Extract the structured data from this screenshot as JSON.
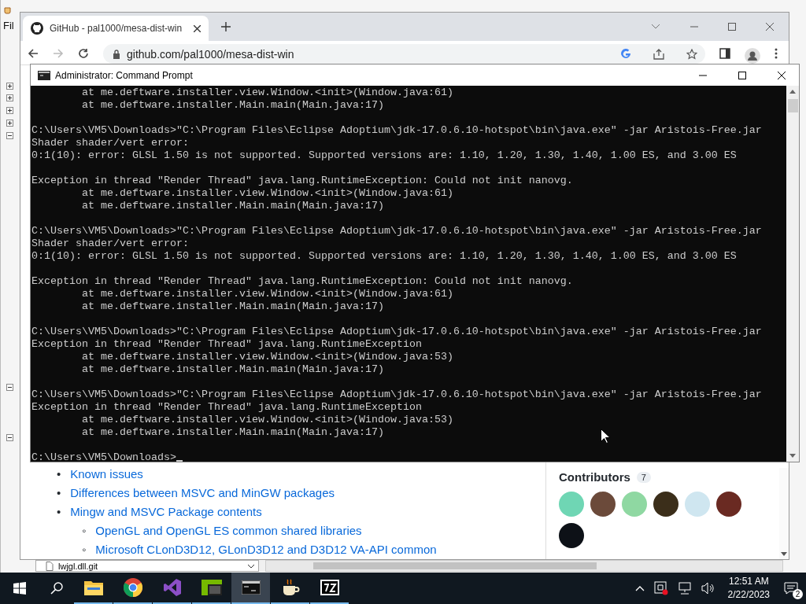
{
  "background_app": {
    "menu": "Fil",
    "tree_nodes": [
      {
        "expanded": false
      },
      {
        "expanded": false
      },
      {
        "expanded": false
      },
      {
        "expanded": false
      },
      {
        "expanded": true
      },
      {
        "expanded": true
      },
      {
        "expanded": true
      }
    ],
    "file": "lwjgl.dll.git"
  },
  "browser": {
    "tab_title": "GitHub - pal1000/mesa-dist-win",
    "url": "github.com/pal1000/mesa-dist-win",
    "toc": [
      {
        "marker": "•",
        "text": "Known issues"
      },
      {
        "marker": "•",
        "text": "Differences between MSVC and MinGW packages"
      },
      {
        "marker": "•",
        "text": "Mingw and MSVC Package contents",
        "children": [
          {
            "marker": "◦",
            "text": "OpenGL and OpenGL ES common shared libraries"
          },
          {
            "marker": "◦",
            "text": "Microsoft CLonD3D12, GLonD3D12 and D3D12 VA-API common"
          }
        ]
      }
    ],
    "contributors": {
      "title": "Contributors",
      "count": "7",
      "avatars": [
        {
          "color": "#6fd6b4"
        },
        {
          "color": "#6b4a3a"
        },
        {
          "color": "#8fd8a2"
        },
        {
          "color": "#3b2e1a"
        },
        {
          "color": "#cfe6f0"
        },
        {
          "color": "#6a2a22"
        },
        {
          "color": "#0d1117"
        }
      ]
    }
  },
  "console": {
    "title": "Administrator:  Command Prompt",
    "blocks": [
      [
        "        at me.deftware.installer.view.Window.<init>(Window.java:61)",
        "        at me.deftware.installer.Main.main(Main.java:17)"
      ],
      [
        "C:\\Users\\VM5\\Downloads>\"C:\\Program Files\\Eclipse Adoptium\\jdk-17.0.6.10-hotspot\\bin\\java.exe\" -jar Aristois-Free.jar",
        "Shader shader/vert error:",
        "0:1(10): error: GLSL 1.50 is not supported. Supported versions are: 1.10, 1.20, 1.30, 1.40, 1.00 ES, and 3.00 ES"
      ],
      [
        "Exception in thread \"Render Thread\" java.lang.RuntimeException: Could not init nanovg.",
        "        at me.deftware.installer.view.Window.<init>(Window.java:61)",
        "        at me.deftware.installer.Main.main(Main.java:17)"
      ],
      [
        "C:\\Users\\VM5\\Downloads>\"C:\\Program Files\\Eclipse Adoptium\\jdk-17.0.6.10-hotspot\\bin\\java.exe\" -jar Aristois-Free.jar",
        "Shader shader/vert error:",
        "0:1(10): error: GLSL 1.50 is not supported. Supported versions are: 1.10, 1.20, 1.30, 1.40, 1.00 ES, and 3.00 ES"
      ],
      [
        "Exception in thread \"Render Thread\" java.lang.RuntimeException: Could not init nanovg.",
        "        at me.deftware.installer.view.Window.<init>(Window.java:61)",
        "        at me.deftware.installer.Main.main(Main.java:17)"
      ],
      [
        "C:\\Users\\VM5\\Downloads>\"C:\\Program Files\\Eclipse Adoptium\\jdk-17.0.6.10-hotspot\\bin\\java.exe\" -jar Aristois-Free.jar",
        "Exception in thread \"Render Thread\" java.lang.RuntimeException",
        "        at me.deftware.installer.view.Window.<init>(Window.java:53)",
        "        at me.deftware.installer.Main.main(Main.java:17)"
      ],
      [
        "C:\\Users\\VM5\\Downloads>\"C:\\Program Files\\Eclipse Adoptium\\jdk-17.0.6.10-hotspot\\bin\\java.exe\" -jar Aristois-Free.jar",
        "Exception in thread \"Render Thread\" java.lang.RuntimeException",
        "        at me.deftware.installer.view.Window.<init>(Window.java:53)",
        "        at me.deftware.installer.Main.main(Main.java:17)"
      ]
    ],
    "prompt": "C:\\Users\\VM5\\Downloads>"
  },
  "taskbar": {
    "apps": [
      {
        "kind": "explorer",
        "selected": false
      },
      {
        "kind": "chrome",
        "selected": false
      },
      {
        "kind": "visualstudio",
        "selected": false
      },
      {
        "kind": "greenapp",
        "selected": false
      },
      {
        "kind": "console",
        "selected": true
      },
      {
        "kind": "java",
        "selected": false
      },
      {
        "kind": "sevenzip",
        "selected": false
      }
    ],
    "time": "12:51 AM",
    "date": "2/22/2023",
    "notifications": "2"
  }
}
